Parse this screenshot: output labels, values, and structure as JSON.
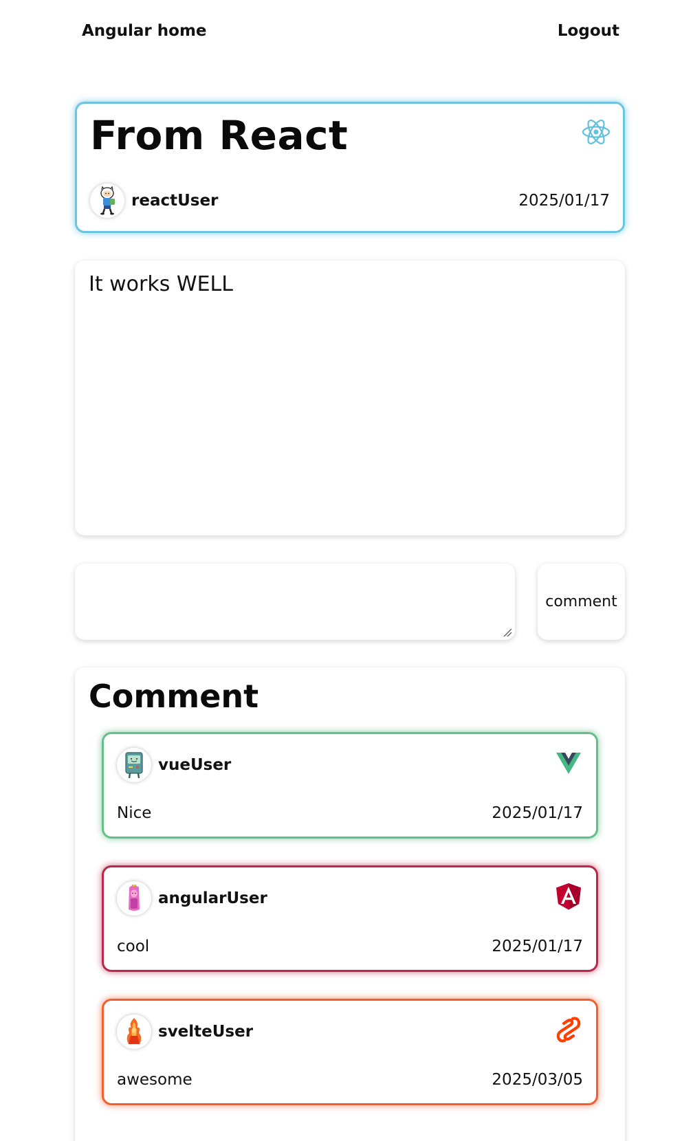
{
  "nav": {
    "home_label": "Angular home",
    "logout_label": "Logout"
  },
  "post": {
    "title": "From React",
    "framework_icon": "react-icon",
    "author": "reactUser",
    "date": "2025/01/17",
    "body": "It works WELL",
    "accent": "#6cc5e0"
  },
  "comment_form": {
    "input_value": "",
    "button_label": "comment"
  },
  "comments": {
    "heading": "Comment",
    "items": [
      {
        "author": "vueUser",
        "text": "Nice",
        "date": "2025/01/17",
        "framework_icon": "vue-icon",
        "accent": "#66bf8a"
      },
      {
        "author": "angularUser",
        "text": "cool",
        "date": "2025/01/17",
        "framework_icon": "angular-icon",
        "accent": "#b8284a"
      },
      {
        "author": "svelteUser",
        "text": "awesome",
        "date": "2025/03/05",
        "framework_icon": "svelte-icon",
        "accent": "#f06030"
      }
    ]
  }
}
